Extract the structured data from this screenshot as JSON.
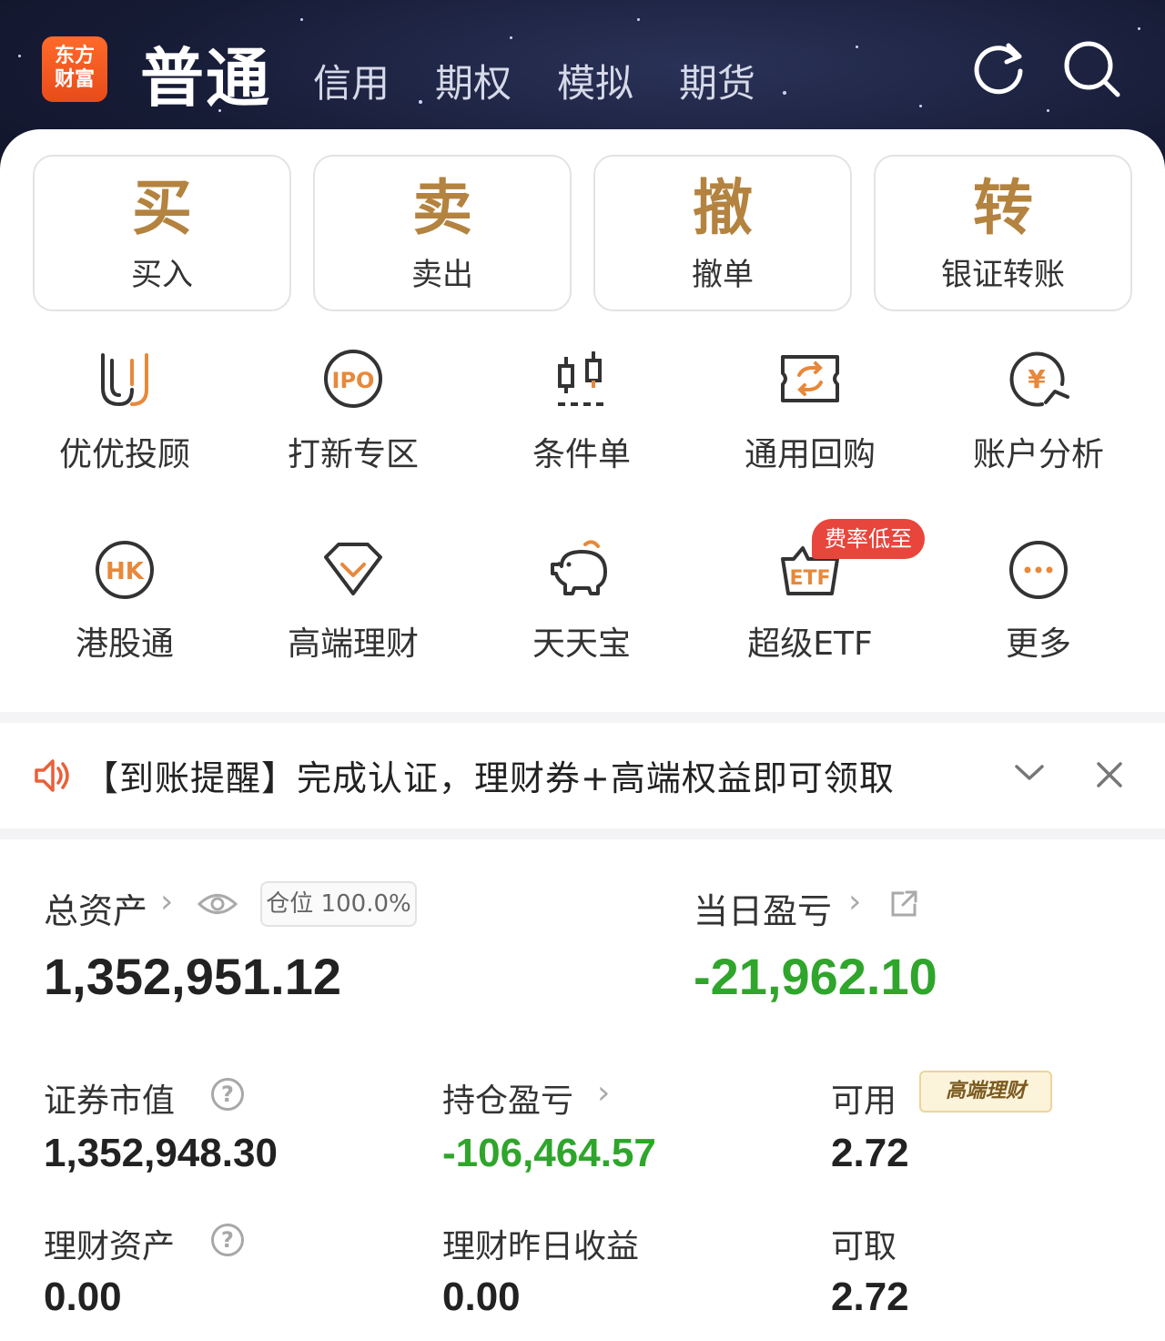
{
  "header": {
    "logo_line1": "东方",
    "logo_line2": "财富",
    "tabs": [
      "普通",
      "信用",
      "期权",
      "模拟",
      "期货"
    ],
    "refresh_icon": "refresh-icon",
    "search_icon": "search-icon"
  },
  "trade_buttons": [
    {
      "big": "买",
      "label": "买入"
    },
    {
      "big": "卖",
      "label": "卖出"
    },
    {
      "big": "撤",
      "label": "撤单"
    },
    {
      "big": "转",
      "label": "银证转账"
    }
  ],
  "grid": [
    {
      "label": "优优投顾",
      "icon": "youyou-icon"
    },
    {
      "label": "打新专区",
      "icon": "ipo-icon"
    },
    {
      "label": "条件单",
      "icon": "candlestick-icon"
    },
    {
      "label": "通用回购",
      "icon": "repurchase-icon"
    },
    {
      "label": "账户分析",
      "icon": "account-analysis-icon"
    },
    {
      "label": "港股通",
      "icon": "hk-icon"
    },
    {
      "label": "高端理财",
      "icon": "diamond-icon"
    },
    {
      "label": "天天宝",
      "icon": "piggy-bank-icon"
    },
    {
      "label": "超级ETF",
      "icon": "etf-icon",
      "badge": "费率低至"
    },
    {
      "label": "更多",
      "icon": "more-icon"
    }
  ],
  "notice": {
    "text": "【到账提醒】完成认证，理财券+高端权益即可领取"
  },
  "assets": {
    "total_label": "总资产",
    "position_badge": "仓位 100.0%",
    "total_value": "1,352,951.12",
    "daily_pl_label": "当日盈亏",
    "daily_pl_value": "-21,962.10",
    "securities_label": "证券市值",
    "securities_value": "1,352,948.30",
    "holding_pl_label": "持仓盈亏",
    "holding_pl_value": "-106,464.57",
    "available_label": "可用",
    "available_badge": "高端理财",
    "available_value": "2.72",
    "wealth_label": "理财资产",
    "wealth_value": "0.00",
    "wealth_yesterday_label": "理财昨日收益",
    "wealth_yesterday_value": "0.00",
    "withdrawable_label": "可取",
    "withdrawable_value": "2.72"
  },
  "colors": {
    "gold": "#b3833f",
    "loss_green": "#2fa52b",
    "badge_red": "#e8453c",
    "header_bg": "#171c36",
    "logo_orange": "#ff6a2a"
  }
}
